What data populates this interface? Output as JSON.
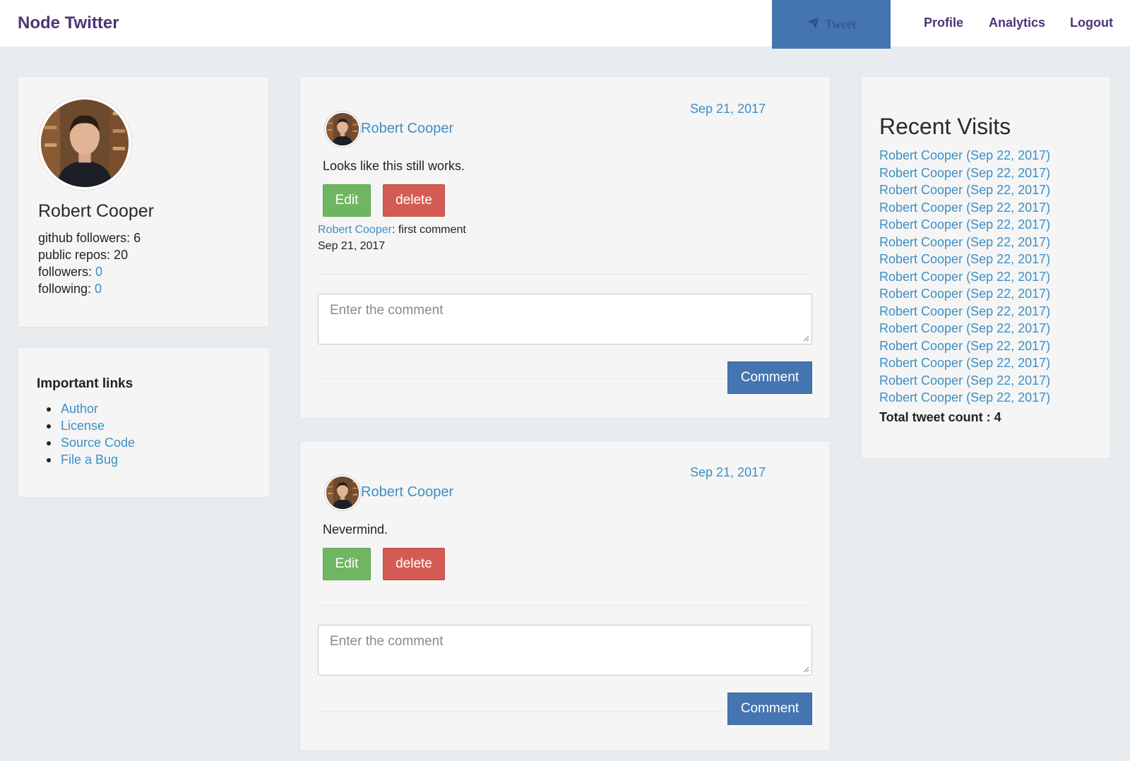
{
  "nav": {
    "brand": "Node Twitter",
    "tweet_label": "Tweet",
    "links": [
      "Profile",
      "Analytics",
      "Logout"
    ]
  },
  "profile": {
    "name": "Robert Cooper",
    "github_followers_label": "github followers: 6",
    "public_repos_label": "public repos: 20",
    "followers_label": "followers: ",
    "followers_count": "0",
    "following_label": "following: ",
    "following_count": "0"
  },
  "links": {
    "title": "Important links",
    "items": [
      "Author",
      "License",
      "Source Code",
      "File a Bug"
    ]
  },
  "tweets": [
    {
      "date": "Sep 21, 2017",
      "author": "Robert Cooper",
      "text": "Looks like this still works.",
      "edit_label": "Edit",
      "delete_label": "delete",
      "comment": {
        "author": "Robert Cooper",
        "text": ": first comment",
        "date": "Sep 21, 2017"
      },
      "comment_placeholder": "Enter the comment",
      "comment_button": "Comment"
    },
    {
      "date": "Sep 21, 2017",
      "author": "Robert Cooper",
      "text": "Nevermind.",
      "edit_label": "Edit",
      "delete_label": "delete",
      "comment_placeholder": "Enter the comment",
      "comment_button": "Comment"
    }
  ],
  "recent_visits": {
    "title": "Recent Visits",
    "items": [
      "Robert Cooper (Sep 22, 2017)",
      "Robert Cooper (Sep 22, 2017)",
      "Robert Cooper (Sep 22, 2017)",
      "Robert Cooper (Sep 22, 2017)",
      "Robert Cooper (Sep 22, 2017)",
      "Robert Cooper (Sep 22, 2017)",
      "Robert Cooper (Sep 22, 2017)",
      "Robert Cooper (Sep 22, 2017)",
      "Robert Cooper (Sep 22, 2017)",
      "Robert Cooper (Sep 22, 2017)",
      "Robert Cooper (Sep 22, 2017)",
      "Robert Cooper (Sep 22, 2017)",
      "Robert Cooper (Sep 22, 2017)",
      "Robert Cooper (Sep 22, 2017)",
      "Robert Cooper (Sep 22, 2017)"
    ],
    "total_label": "Total tweet count : 4"
  },
  "colors": {
    "brand": "#4b3576",
    "link": "#3d8fc4",
    "primary": "#4575b1",
    "success": "#6fb562",
    "danger": "#d45b53",
    "background": "#e8ecef"
  }
}
